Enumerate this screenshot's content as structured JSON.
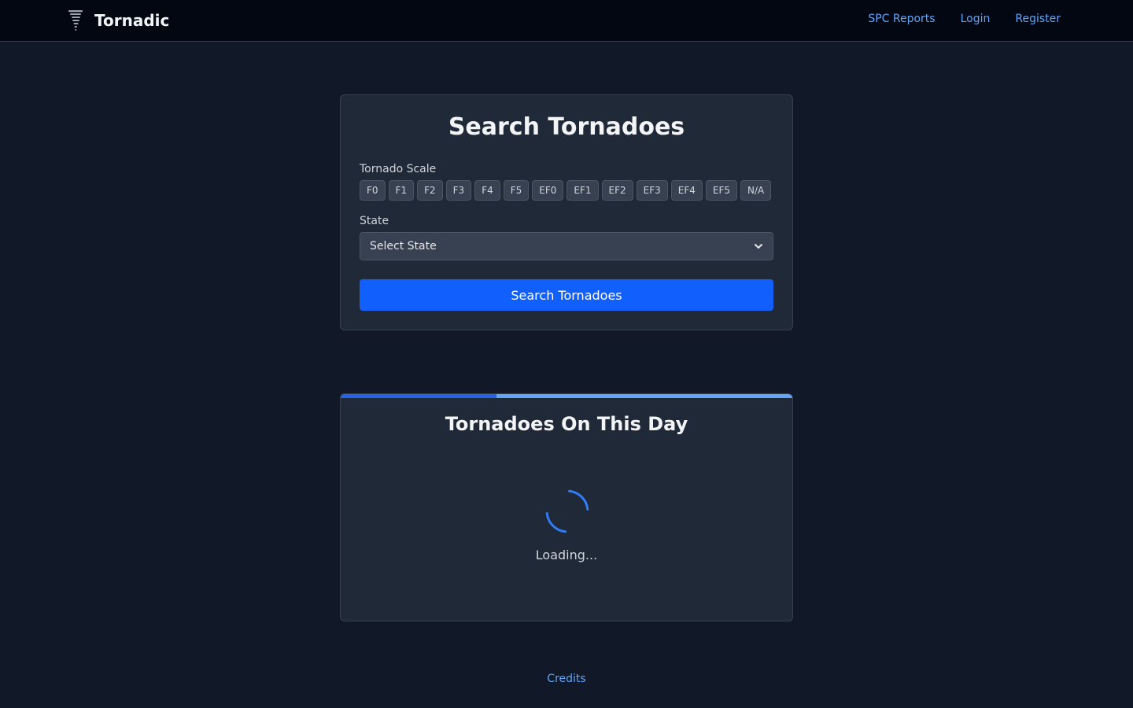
{
  "nav": {
    "brand": "Tornadic",
    "links": [
      "SPC Reports",
      "Login",
      "Register"
    ]
  },
  "search": {
    "title": "Search Tornadoes",
    "scale_label": "Tornado Scale",
    "scales": [
      "F0",
      "F1",
      "F2",
      "F3",
      "F4",
      "F5",
      "EF0",
      "EF1",
      "EF2",
      "EF3",
      "EF4",
      "EF5",
      "N/A"
    ],
    "state_label": "State",
    "state_selected": "Select State",
    "button": "Search Tornadoes"
  },
  "on_this_day": {
    "title": "Tornadoes On This Day",
    "progress": 0.345,
    "loading": "Loading..."
  },
  "footer": {
    "credits": "Credits"
  },
  "colors": {
    "accent": "#1160fd",
    "link": "#60a5fa",
    "spinner": "#2f7df6"
  },
  "icons": {
    "brand": "tornado-icon",
    "select": "chevron-down-icon",
    "loading": "spinner-icon"
  }
}
